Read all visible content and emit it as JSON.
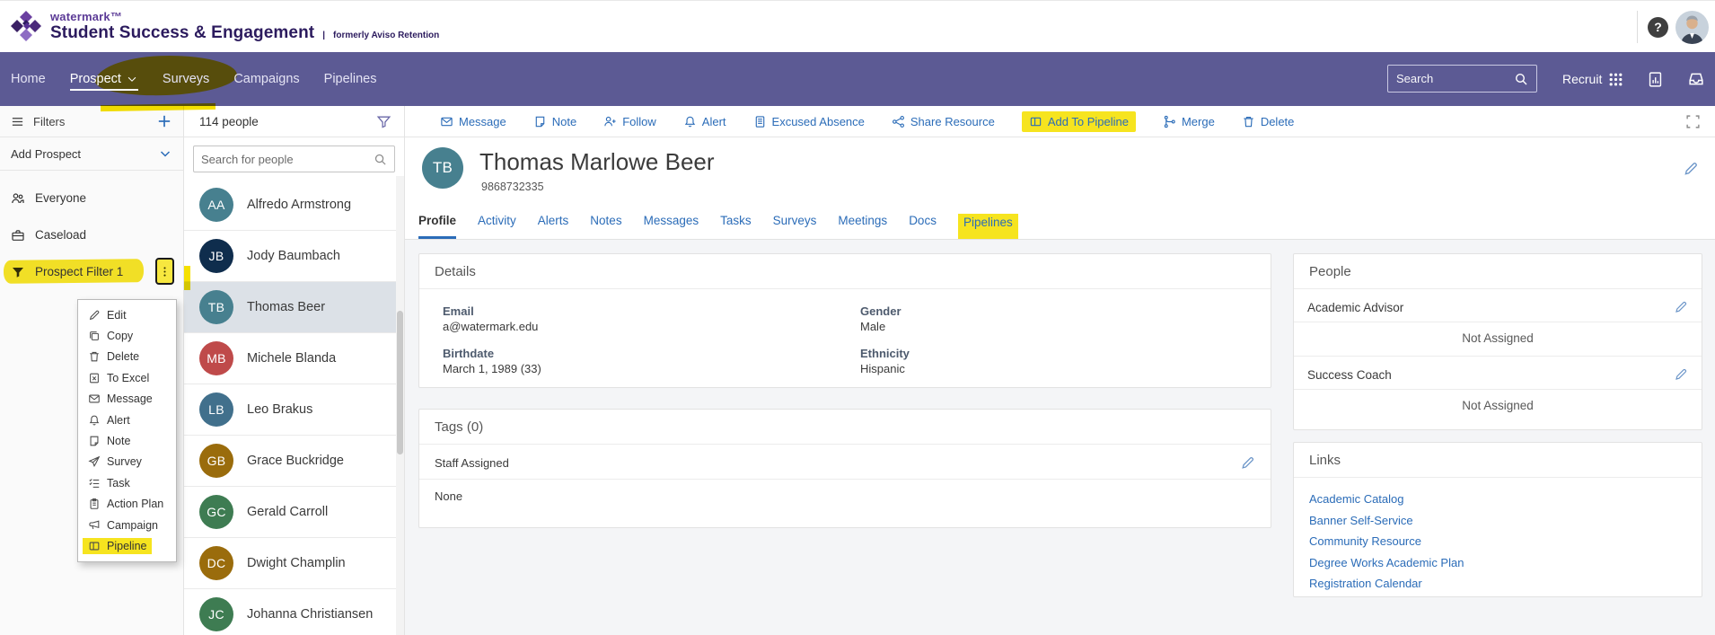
{
  "brand": {
    "name": "watermark™",
    "product": "Student Success & Engagement",
    "tagline_sep": "|",
    "tagline": "formerly Aviso Retention",
    "logo_icon": "watermark-pinwheel-icon"
  },
  "topbar": {
    "help_icon": "help-icon",
    "avatar_icon": "user-avatar"
  },
  "nav": {
    "items": [
      {
        "label": "Home"
      },
      {
        "label": "Prospect",
        "active": true,
        "chevron": true,
        "highlight": true
      },
      {
        "label": "Surveys"
      },
      {
        "label": "Campaigns"
      },
      {
        "label": "Pipelines"
      }
    ],
    "search_placeholder": "Search",
    "search_icon": "search-icon",
    "recruit_label": "Recruit",
    "recruit_icon": "waffle-grid-icon",
    "report_icon": "report-icon",
    "inbox_icon": "inbox-icon"
  },
  "sidebar": {
    "filters_label": "Filters",
    "filters_icon": "hamburger-icon",
    "add_filter_icon": "plus-icon",
    "add_prospect_label": "Add Prospect",
    "add_prospect_icon": "chevron-down-icon",
    "items": [
      {
        "label": "Everyone",
        "icon": "people-icon"
      },
      {
        "label": "Caseload",
        "icon": "briefcase-icon"
      },
      {
        "label": "Prospect Filter 1",
        "icon": "funnel-filled-icon",
        "highlight": true,
        "kebab": true
      }
    ]
  },
  "context_menu": {
    "items": [
      {
        "label": "Edit",
        "icon": "pencil-icon"
      },
      {
        "label": "Copy",
        "icon": "copy-icon"
      },
      {
        "label": "Delete",
        "icon": "trash-icon"
      },
      {
        "label": "To Excel",
        "icon": "excel-icon"
      },
      {
        "label": "Message",
        "icon": "envelope-icon"
      },
      {
        "label": "Alert",
        "icon": "bell-icon"
      },
      {
        "label": "Note",
        "icon": "note-icon"
      },
      {
        "label": "Survey",
        "icon": "send-icon"
      },
      {
        "label": "Task",
        "icon": "task-icon"
      },
      {
        "label": "Action Plan",
        "icon": "clipboard-icon"
      },
      {
        "label": "Campaign",
        "icon": "megaphone-icon"
      },
      {
        "label": "Pipeline",
        "icon": "pipeline-icon",
        "highlight": true
      }
    ]
  },
  "people_list": {
    "count_label": "114 people",
    "filter_icon": "funnel-outline-icon",
    "search_placeholder": "Search for people",
    "search_icon": "search-icon",
    "people": [
      {
        "name": "Alfredo Armstrong",
        "initials": "AA",
        "color": "#47808f"
      },
      {
        "name": "Jody Baumbach",
        "initials": "JB",
        "color": "#0f2d4d"
      },
      {
        "name": "Thomas Beer",
        "initials": "TB",
        "color": "#47808f",
        "selected": true
      },
      {
        "name": "Michele Blanda",
        "initials": "MB",
        "color": "#bf4a4a"
      },
      {
        "name": "Leo Brakus",
        "initials": "LB",
        "color": "#41708c"
      },
      {
        "name": "Grace Buckridge",
        "initials": "GB",
        "color": "#9a6c0c"
      },
      {
        "name": "Gerald Carroll",
        "initials": "GC",
        "color": "#3e7c52"
      },
      {
        "name": "Dwight Champlin",
        "initials": "DC",
        "color": "#9a6c0c"
      },
      {
        "name": "Johanna Christiansen",
        "initials": "JC",
        "color": "#3e7c52"
      }
    ]
  },
  "toolbar": {
    "actions": [
      {
        "label": "Message",
        "icon": "envelope-icon"
      },
      {
        "label": "Note",
        "icon": "note-icon"
      },
      {
        "label": "Follow",
        "icon": "person-plus-icon"
      },
      {
        "label": "Alert",
        "icon": "bell-icon"
      },
      {
        "label": "Excused Absence",
        "icon": "document-icon"
      },
      {
        "label": "Share Resource",
        "icon": "share-icon"
      },
      {
        "label": "Add To Pipeline",
        "icon": "pipeline-icon",
        "highlight": true
      },
      {
        "label": "Merge",
        "icon": "merge-icon"
      },
      {
        "label": "Delete",
        "icon": "trash-icon"
      }
    ],
    "fullscreen_icon": "fullscreen-icon"
  },
  "profile": {
    "initials": "TB",
    "avatar_color": "#47808f",
    "name": "Thomas Marlowe Beer",
    "phone": "9868732335",
    "edit_icon": "pencil-icon",
    "tabs": [
      {
        "label": "Profile",
        "active": true
      },
      {
        "label": "Activity"
      },
      {
        "label": "Alerts"
      },
      {
        "label": "Notes"
      },
      {
        "label": "Messages"
      },
      {
        "label": "Tasks"
      },
      {
        "label": "Surveys"
      },
      {
        "label": "Meetings"
      },
      {
        "label": "Docs"
      },
      {
        "label": "Pipelines",
        "highlight": true
      }
    ],
    "details": {
      "title": "Details",
      "columns": [
        [
          {
            "label": "Email",
            "value": "a@watermark.edu"
          },
          {
            "label": "Birthdate",
            "value": "March 1, 1989 (33)"
          }
        ],
        [
          {
            "label": "Gender",
            "value": "Male"
          },
          {
            "label": "Ethnicity",
            "value": "Hispanic"
          }
        ]
      ]
    },
    "tags": {
      "title": "Tags (0)",
      "section_label": "Staff Assigned",
      "value": "None",
      "edit_icon": "pencil-icon"
    },
    "people_panel": {
      "title": "People",
      "roles": [
        {
          "label": "Academic Advisor",
          "value": "Not Assigned",
          "edit_icon": "pencil-icon"
        },
        {
          "label": "Success Coach",
          "value": "Not Assigned",
          "edit_icon": "pencil-icon"
        }
      ]
    },
    "links_panel": {
      "title": "Links",
      "links": [
        "Academic Catalog",
        "Banner Self-Service",
        "Community Resource",
        "Degree Works Academic Plan",
        "Registration Calendar"
      ]
    }
  },
  "colors": {
    "nav_purple": "#5c5a94",
    "accent_blue": "#2b6cb8",
    "brand_purple": "#2c1b5e",
    "highlight_yellow": "#f5e000",
    "selected_row": "#dce1e7"
  }
}
